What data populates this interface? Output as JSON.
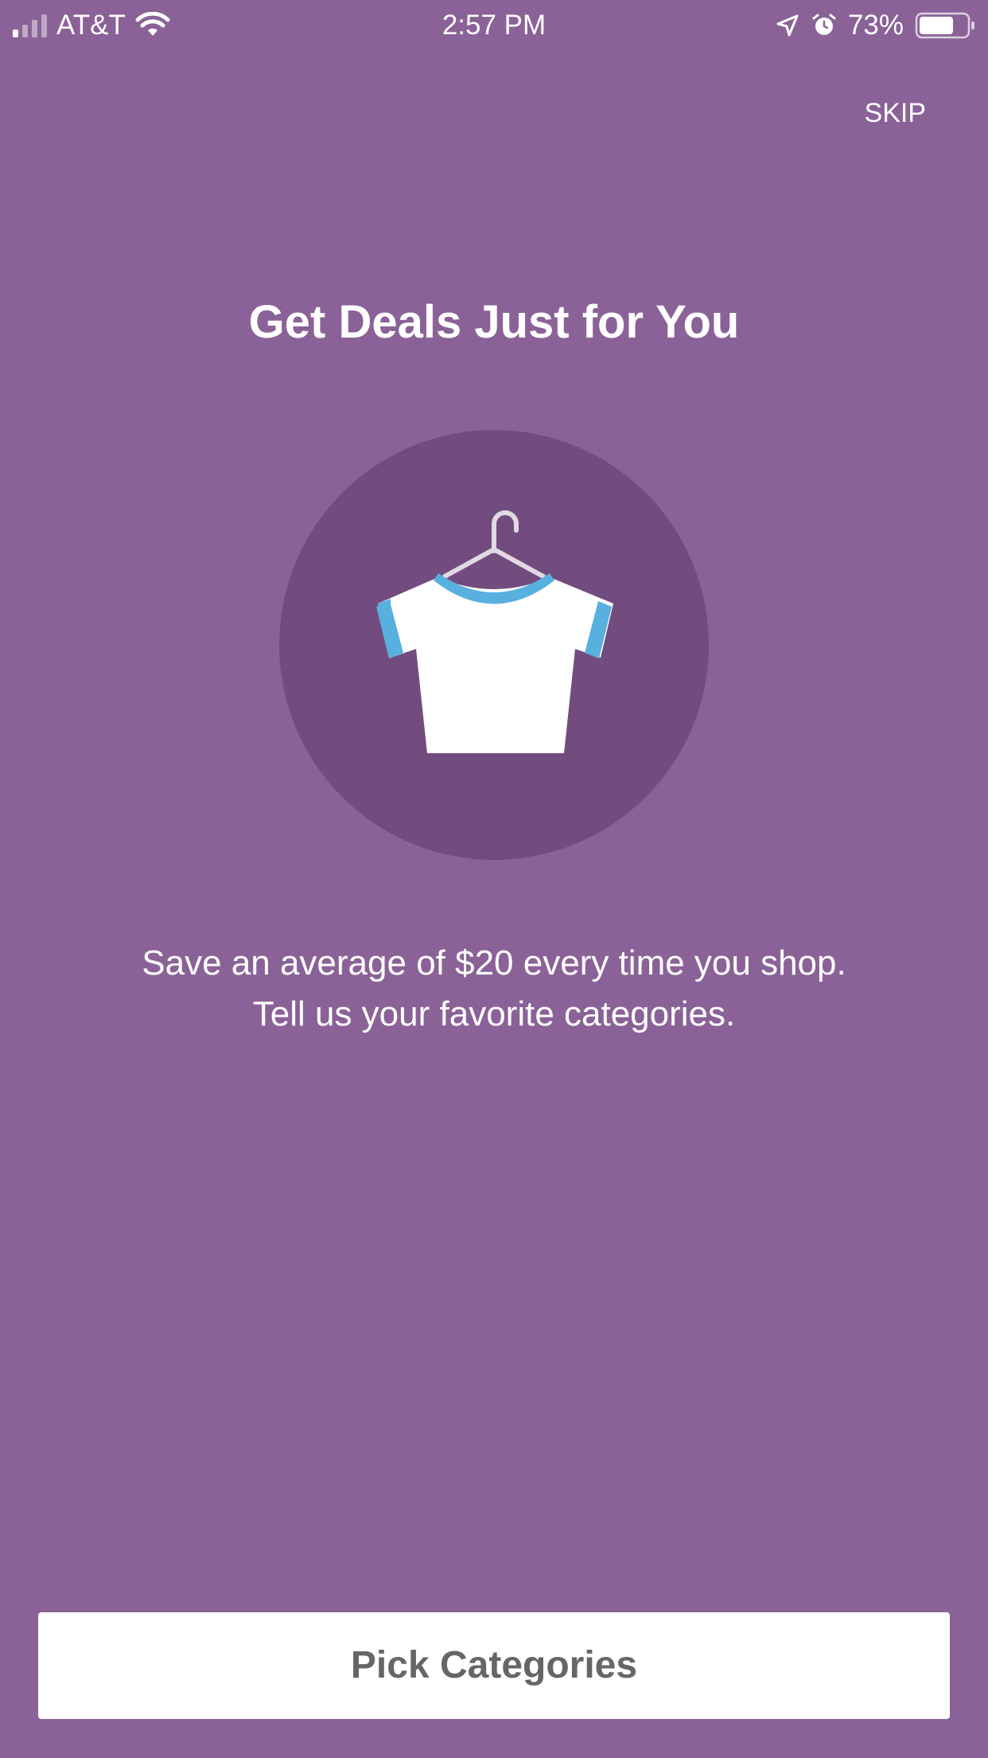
{
  "status_bar": {
    "carrier": "AT&T",
    "time": "2:57 PM",
    "battery_percent": "73%",
    "battery_level": 0.73,
    "signal_bars_filled": 1,
    "signal_bars_total": 4,
    "icons": [
      "signal-icon",
      "wifi-icon",
      "location-icon",
      "alarm-icon",
      "battery-icon"
    ]
  },
  "header": {
    "skip_label": "SKIP"
  },
  "onboarding": {
    "title": "Get Deals Just for You",
    "illustration": "shirt-on-hanger-icon",
    "description_line1": "Save an average of $20 every time you shop.",
    "description_line2": "Tell us your favorite categories."
  },
  "actions": {
    "primary_label": "Pick Categories"
  },
  "colors": {
    "background": "#8a6297",
    "circle": "#724c7f",
    "accent_blue": "#58b0de",
    "button_bg": "#ffffff",
    "button_text": "#666666"
  }
}
